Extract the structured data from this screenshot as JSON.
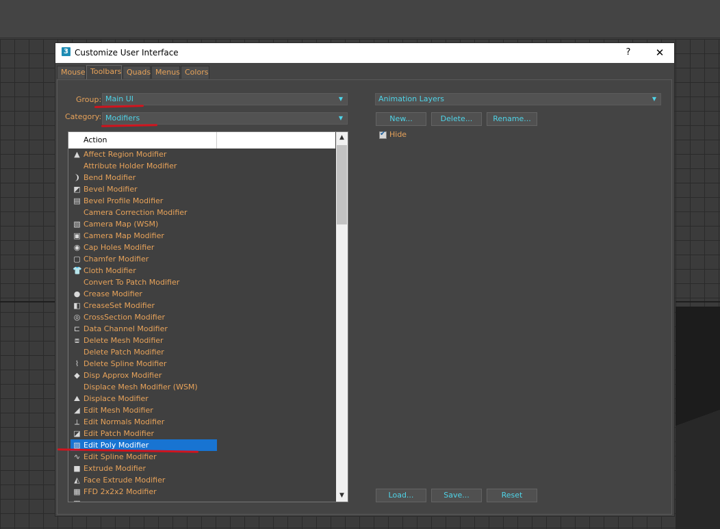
{
  "dialog": {
    "app_icon": "3",
    "title": "Customize User Interface",
    "help": "?",
    "close": "✕"
  },
  "tabs": [
    "Mouse",
    "Toolbars",
    "Quads",
    "Menus",
    "Colors"
  ],
  "active_tab": "Toolbars",
  "left": {
    "group_label": "Group:",
    "group_value": "Main UI",
    "category_label": "Category:",
    "category_value": "Modifiers",
    "action_header": "Action",
    "selected": "Edit Poly Modifier",
    "items": [
      {
        "label": "Affect Region Modifier",
        "icon": "affect-region-icon",
        "glyph": "▲"
      },
      {
        "label": "Attribute Holder Modifier",
        "icon": "",
        "glyph": ""
      },
      {
        "label": "Bend Modifier",
        "icon": "bend-icon",
        "glyph": "❩"
      },
      {
        "label": "Bevel Modifier",
        "icon": "bevel-icon",
        "glyph": "◩"
      },
      {
        "label": "Bevel Profile Modifier",
        "icon": "bevel-profile-icon",
        "glyph": "▤"
      },
      {
        "label": "Camera Correction Modifier",
        "icon": "",
        "glyph": ""
      },
      {
        "label": "Camera Map (WSM)",
        "icon": "camera-map-wsm-icon",
        "glyph": "▧"
      },
      {
        "label": "Camera Map Modifier",
        "icon": "camera-map-icon",
        "glyph": "▣"
      },
      {
        "label": "Cap Holes Modifier",
        "icon": "cap-holes-icon",
        "glyph": "◉"
      },
      {
        "label": "Chamfer Modifier",
        "icon": "chamfer-icon",
        "glyph": "▢"
      },
      {
        "label": "Cloth Modifier",
        "icon": "cloth-icon",
        "glyph": "👕"
      },
      {
        "label": "Convert To Patch Modifier",
        "icon": "",
        "glyph": ""
      },
      {
        "label": "Crease Modifier",
        "icon": "crease-icon",
        "glyph": "●"
      },
      {
        "label": "CreaseSet Modifier",
        "icon": "creaseset-icon",
        "glyph": "◧"
      },
      {
        "label": "CrossSection Modifier",
        "icon": "crosssection-icon",
        "glyph": "◎"
      },
      {
        "label": "Data Channel Modifier",
        "icon": "data-channel-icon",
        "glyph": "⊏"
      },
      {
        "label": "Delete Mesh Modifier",
        "icon": "delete-mesh-icon",
        "glyph": "⧈"
      },
      {
        "label": "Delete Patch Modifier",
        "icon": "",
        "glyph": ""
      },
      {
        "label": "Delete Spline Modifier",
        "icon": "delete-spline-icon",
        "glyph": "⌇"
      },
      {
        "label": "Disp Approx Modifier",
        "icon": "disp-approx-icon",
        "glyph": "◆"
      },
      {
        "label": "Displace Mesh Modifier (WSM)",
        "icon": "",
        "glyph": ""
      },
      {
        "label": "Displace Modifier",
        "icon": "displace-icon",
        "glyph": "⛰"
      },
      {
        "label": "Edit Mesh Modifier",
        "icon": "edit-mesh-icon",
        "glyph": "◢"
      },
      {
        "label": "Edit Normals Modifier",
        "icon": "edit-normals-icon",
        "glyph": "⟂"
      },
      {
        "label": "Edit Patch Modifier",
        "icon": "edit-patch-icon",
        "glyph": "◪"
      },
      {
        "label": "Edit Poly Modifier",
        "icon": "edit-poly-icon",
        "glyph": "▨"
      },
      {
        "label": "Edit Spline Modifier",
        "icon": "edit-spline-icon",
        "glyph": "∿"
      },
      {
        "label": "Extrude Modifier",
        "icon": "extrude-icon",
        "glyph": "■"
      },
      {
        "label": "Face Extrude Modifier",
        "icon": "face-extrude-icon",
        "glyph": "◭"
      },
      {
        "label": "FFD 2x2x2 Modifier",
        "icon": "ffd-icon",
        "glyph": "▦"
      },
      {
        "label": "",
        "icon": "",
        "glyph": "▦"
      }
    ]
  },
  "right": {
    "toolbar_value": "Animation Layers",
    "new_btn": "New...",
    "delete_btn": "Delete...",
    "rename_btn": "Rename...",
    "hide_label": "Hide",
    "hide_checked": true,
    "load_btn": "Load...",
    "save_btn": "Save...",
    "reset_btn": "Reset"
  },
  "colors": {
    "accent_text": "#e8a35a",
    "value_text": "#4fd4e8",
    "selection": "#1874d2",
    "annotation": "#d0141e"
  }
}
